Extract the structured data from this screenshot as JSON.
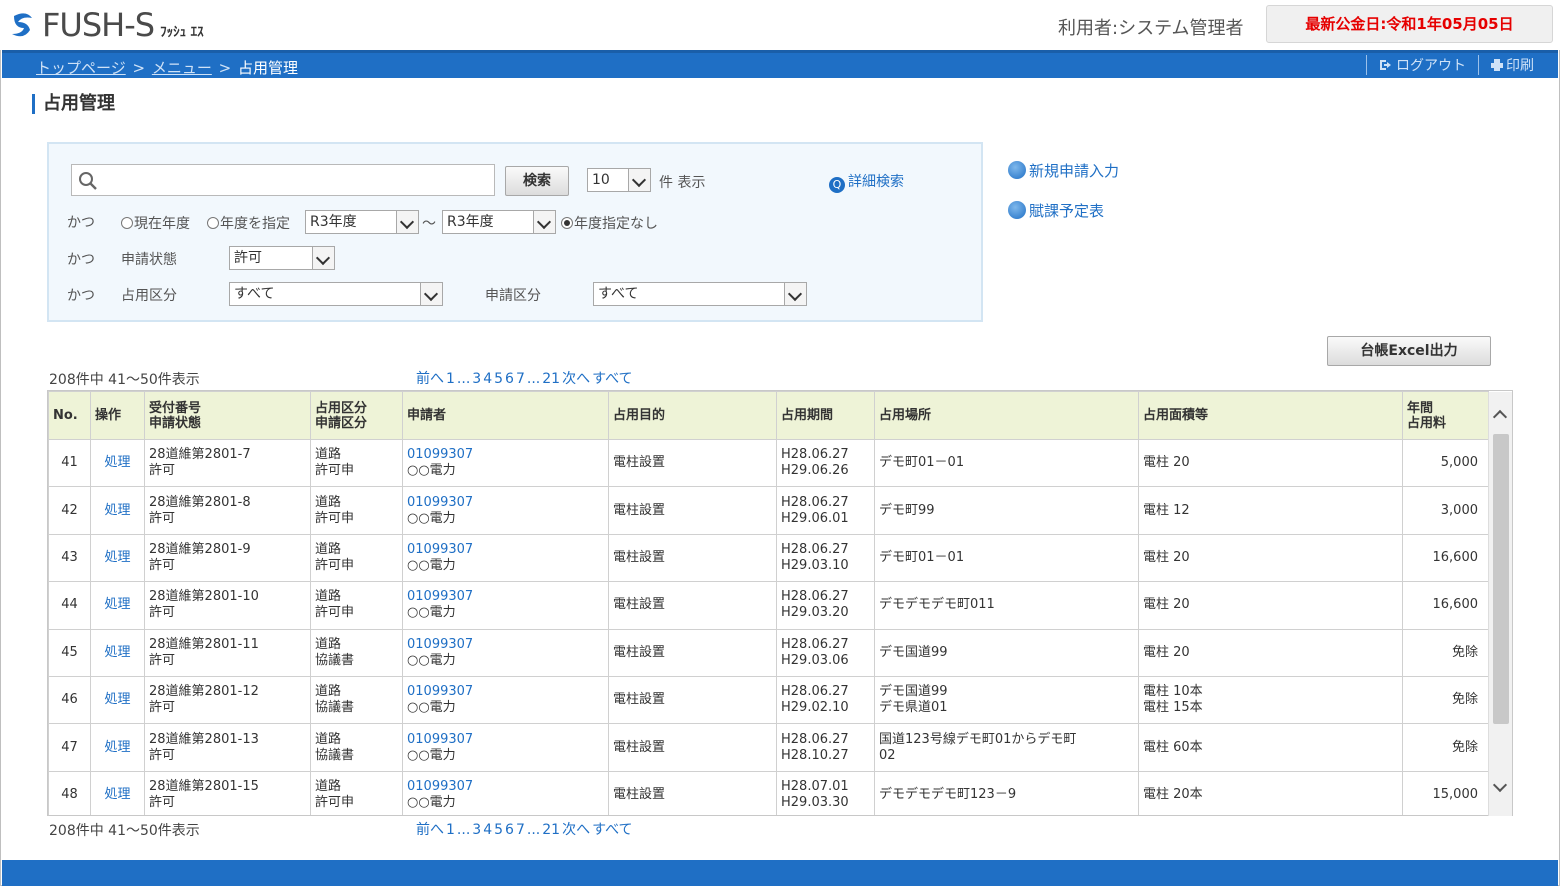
{
  "header": {
    "logo_text": "FUSH-S",
    "logo_sub": "ﾌｯｼｭ ｴｽ",
    "user": "利用者:システム管理者",
    "date_label": "最新公金日:令和1年05月05日"
  },
  "nav": {
    "crumb_top": "トップページ",
    "crumb_menu": "メニュー",
    "crumb_current": "占用管理",
    "sep": ">",
    "logout": "ログアウト",
    "print": "印刷"
  },
  "page_title": "占用管理",
  "search": {
    "placeholder": "",
    "button": "検索",
    "per_page": "10",
    "per_page_suffix": "件 表示",
    "advanced": "詳細検索",
    "and1": "かつ",
    "radio_current": "現在年度",
    "radio_specify": "年度を指定",
    "year_from": "R3年度",
    "tilde": "～",
    "year_to": "R3年度",
    "radio_none": "年度指定なし",
    "and2": "かつ",
    "status_label": "申請状態",
    "status_value": "許可",
    "and3": "かつ",
    "occupy_label": "占用区分",
    "occupy_value": "すべて",
    "apply_label": "申請区分",
    "apply_value": "すべて"
  },
  "side_links": {
    "new_entry": "新規申請入力",
    "tax_schedule": "賦課予定表"
  },
  "excel_button": "台帳Excel出力",
  "summary_text": "208件中 41～50件表示",
  "pager": [
    "前へ",
    "1",
    "...",
    "3",
    "4",
    "5",
    "6",
    "7",
    "...",
    "21",
    "次へ",
    "すべて"
  ],
  "table": {
    "headers": [
      "No.",
      "操作",
      "受付番号\n申請状態",
      "占用区分\n申請区分",
      "申請者",
      "占用目的",
      "占用期間",
      "占用場所",
      "占用面積等",
      "年間\n占用料"
    ],
    "rows": [
      {
        "no": "41",
        "op": "処理",
        "rec": "28道維第2801-7",
        "state": "許可",
        "kind": "道路",
        "kind2": "許可申",
        "code": "01099307",
        "name": "○○電力",
        "purpose": "電柱設置",
        "from": "H28.06.27",
        "to": "H29.06.26",
        "place": "デモ町01－01",
        "place2": "",
        "area": "電柱 20",
        "area2": "",
        "fee": "5,000"
      },
      {
        "no": "42",
        "op": "処理",
        "rec": "28道維第2801-8",
        "state": "許可",
        "kind": "道路",
        "kind2": "許可申",
        "code": "01099307",
        "name": "○○電力",
        "purpose": "電柱設置",
        "from": "H28.06.27",
        "to": "H29.06.01",
        "place": "デモ町99",
        "place2": "",
        "area": "電柱 12",
        "area2": "",
        "fee": "3,000"
      },
      {
        "no": "43",
        "op": "処理",
        "rec": "28道維第2801-9",
        "state": "許可",
        "kind": "道路",
        "kind2": "許可申",
        "code": "01099307",
        "name": "○○電力",
        "purpose": "電柱設置",
        "from": "H28.06.27",
        "to": "H29.03.10",
        "place": "デモ町01－01",
        "place2": "",
        "area": "電柱 20",
        "area2": "",
        "fee": "16,600"
      },
      {
        "no": "44",
        "op": "処理",
        "rec": "28道維第2801-10",
        "state": "許可",
        "kind": "道路",
        "kind2": "許可申",
        "code": "01099307",
        "name": "○○電力",
        "purpose": "電柱設置",
        "from": "H28.06.27",
        "to": "H29.03.20",
        "place": "デモデモデモ町011",
        "place2": "",
        "area": "電柱 20",
        "area2": "",
        "fee": "16,600"
      },
      {
        "no": "45",
        "op": "処理",
        "rec": "28道維第2801-11",
        "state": "許可",
        "kind": "道路",
        "kind2": "協議書",
        "code": "01099307",
        "name": "○○電力",
        "purpose": "電柱設置",
        "from": "H28.06.27",
        "to": "H29.03.06",
        "place": "デモ国道99",
        "place2": "",
        "area": "電柱 20",
        "area2": "",
        "fee": "免除"
      },
      {
        "no": "46",
        "op": "処理",
        "rec": "28道維第2801-12",
        "state": "許可",
        "kind": "道路",
        "kind2": "協議書",
        "code": "01099307",
        "name": "○○電力",
        "purpose": "電柱設置",
        "from": "H28.06.27",
        "to": "H29.02.10",
        "place": "デモ国道99",
        "place2": "デモ県道01",
        "area": "電柱 10本",
        "area2": "電柱 15本",
        "fee": "免除"
      },
      {
        "no": "47",
        "op": "処理",
        "rec": "28道維第2801-13",
        "state": "許可",
        "kind": "道路",
        "kind2": "協議書",
        "code": "01099307",
        "name": "○○電力",
        "purpose": "電柱設置",
        "from": "H28.06.27",
        "to": "H28.10.27",
        "place": "国道123号線デモ町01からデモ町",
        "place2": "02",
        "area": "電柱 60本",
        "area2": "",
        "fee": "免除"
      },
      {
        "no": "48",
        "op": "処理",
        "rec": "28道維第2801-15",
        "state": "許可",
        "kind": "道路",
        "kind2": "許可申",
        "code": "01099307",
        "name": "○○電力",
        "purpose": "電柱設置",
        "from": "H28.07.01",
        "to": "H29.03.30",
        "place": "デモデモデモ町123－9",
        "place2": "",
        "area": "電柱 20本",
        "area2": "",
        "fee": "15,000"
      }
    ]
  },
  "colors": {
    "brand_blue": "#1f6fc5",
    "date_red": "#e60000",
    "header_row": "#eef3d7"
  }
}
